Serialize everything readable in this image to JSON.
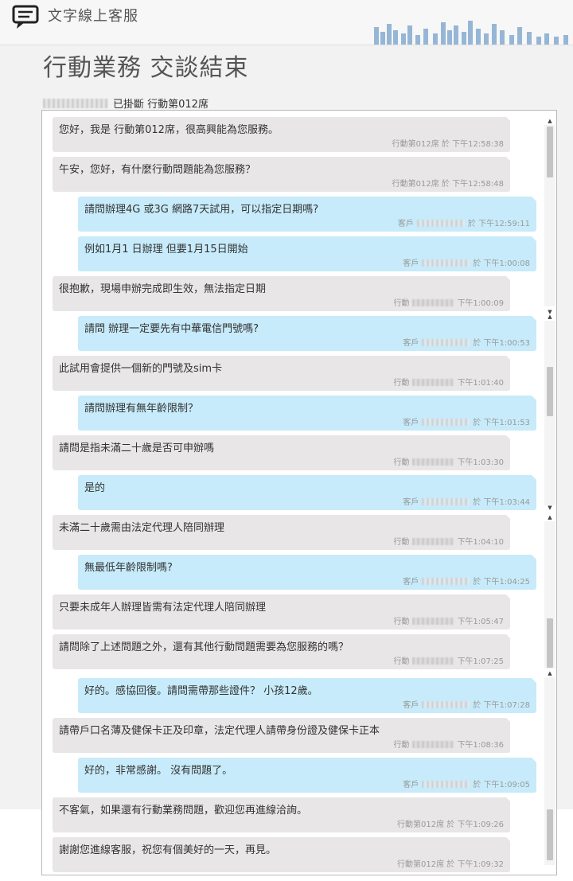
{
  "app": {
    "title": "文字線上客服"
  },
  "header": {
    "page_title": "行動業務 交談結束",
    "status_text": "已掛斷 行動第012席"
  },
  "messages": [
    {
      "role": "agent",
      "text": "您好，我是 行動第012席，很高興能為您服務。",
      "sender": "行動第012席",
      "meta": "於 下午12:58:38"
    },
    {
      "role": "agent",
      "text": "午安，您好，有什麼行動問題能為您服務？",
      "sender": "行動第012席",
      "meta": "於 下午12:58:48"
    },
    {
      "role": "customer",
      "text": "請問辦理4G 或3G 網路7天試用，可以指定日期嗎?",
      "sender": "客戶",
      "meta": "於 下午12:59:11"
    },
    {
      "role": "customer",
      "text": "例如1月1 日辦理 但要1月15日開始",
      "sender": "客戶",
      "meta": "於 下午1:00:08"
    },
    {
      "role": "agent",
      "text": "很抱歉，現場申辦完成即生效，無法指定日期",
      "sender": "行動",
      "meta": "下午1:00:09"
    },
    {
      "role": "customer",
      "text": "請問 辦理一定要先有中華電信門號嗎?",
      "sender": "客戶",
      "meta": "於 下午1:00:53"
    },
    {
      "role": "agent",
      "text": "此試用會提供一個新的門號及sim卡",
      "sender": "行動",
      "meta": "下午1:01:40"
    },
    {
      "role": "customer",
      "text": "請問辦理有無年齡限制？",
      "sender": "客戶",
      "meta": "於 下午1:01:53"
    },
    {
      "role": "agent",
      "text": "請問是指未滿二十歲是否可申辦嗎",
      "sender": "行動",
      "meta": "下午1:03:30"
    },
    {
      "role": "customer",
      "text": "是的",
      "sender": "客戶",
      "meta": "於 下午1:03:44"
    },
    {
      "role": "agent",
      "text": "未滿二十歲需由法定代理人陪同辦理",
      "sender": "行動",
      "meta": "下午1:04:10"
    },
    {
      "role": "customer",
      "text": "無最低年齡限制嗎?",
      "sender": "客戶",
      "meta": "於 下午1:04:25"
    },
    {
      "role": "agent",
      "text": "只要未成年人辦理皆需有法定代理人陪同辦理",
      "sender": "行動",
      "meta": "下午1:05:47"
    },
    {
      "role": "agent",
      "text": "請問除了上述問題之外，還有其他行動問題需要為您服務的嗎？",
      "sender": "行動",
      "meta": "下午1:07:25"
    },
    {
      "role": "customer",
      "text": "好的。感協回復。請問需帶那些證件？ 小孩12歲。",
      "sender": "客戶",
      "meta": "於 下午1:07:28"
    },
    {
      "role": "agent",
      "text": "請帶戶口名薄及健保卡正及印章，法定代理人請帶身份證及健保卡正本",
      "sender": "行動",
      "meta": "下午1:08:36"
    },
    {
      "role": "customer",
      "text": "好的，非常感謝。 沒有問題了。",
      "sender": "客戶",
      "meta": "於 下午1:09:05"
    },
    {
      "role": "agent",
      "text": "不客氣，如果還有行動業務問題，歡迎您再進線洽詢。",
      "sender": "行動第012席",
      "meta": "於 下午1:09:26"
    },
    {
      "role": "agent",
      "text": "謝謝您進線客服，祝您有個美好的一天，再見。",
      "sender": "行動第012席",
      "meta": "於 下午1:09:32"
    }
  ]
}
